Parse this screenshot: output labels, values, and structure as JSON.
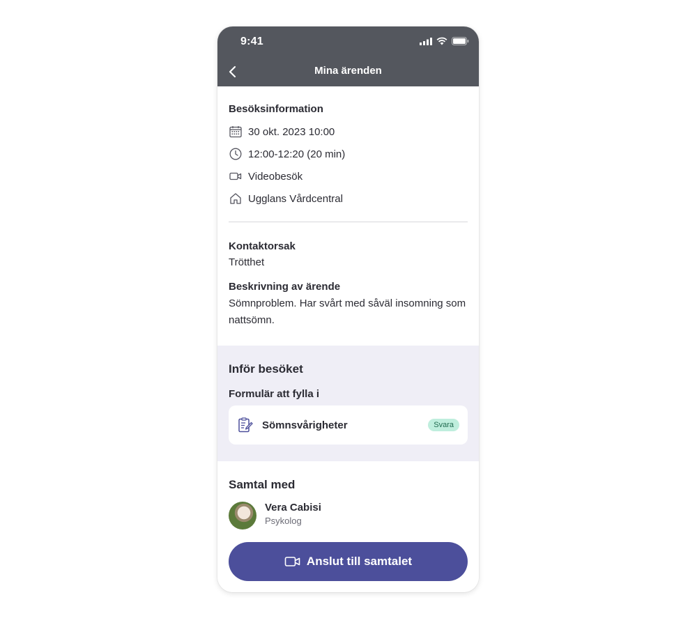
{
  "status_bar": {
    "time": "9:41"
  },
  "nav": {
    "title": "Mina ärenden"
  },
  "visit_info": {
    "heading": "Besöksinformation",
    "date": "30 okt. 2023 10:00",
    "time": "12:00-12:20 (20 min)",
    "type": "Videobesök",
    "location": "Ugglans Vårdcentral"
  },
  "contact": {
    "reason_label": "Kontaktorsak",
    "reason_value": "Trötthet",
    "description_label": "Beskrivning av ärende",
    "description_value": "Sömnproblem. Har svårt med såväl insomning som nattsömn."
  },
  "prep": {
    "heading": "Inför besöket",
    "forms_label": "Formulär att fylla i",
    "form_name": "Sömnsvårigheter",
    "form_badge": "Svara"
  },
  "conversation": {
    "heading": "Samtal med",
    "person_name": "Vera Cabisi",
    "person_role": "Psykolog"
  },
  "join_button": {
    "label": "Anslut till samtalet"
  },
  "colors": {
    "header": "#54575e",
    "accent": "#4c4f9b",
    "prep_bg": "#efeef6",
    "badge_bg": "#bfeedd"
  },
  "icons": [
    "back-chevron-icon",
    "calendar-icon",
    "clock-icon",
    "video-icon",
    "home-icon",
    "form-icon",
    "video-icon"
  ]
}
